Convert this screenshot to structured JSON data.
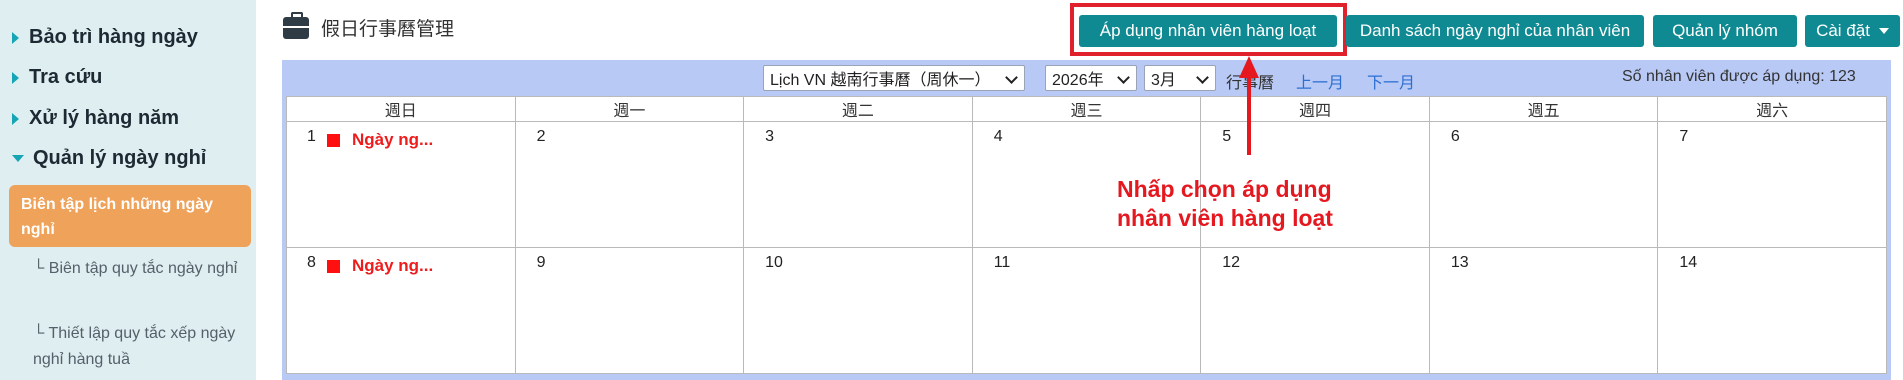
{
  "sidebar": {
    "items": [
      {
        "label": "Bảo trì hàng ngày"
      },
      {
        "label": "Tra cứu"
      },
      {
        "label": "Xử lý hàng năm"
      },
      {
        "label": "Quản lý ngày nghỉ"
      }
    ],
    "active_item": "Biên tập lịch những ngày nghỉ",
    "sub_items": [
      {
        "label": "└ Biên tập quy tắc ngày nghỉ"
      },
      {
        "label": "└ Thiết lập quy tắc xếp ngày nghỉ hàng tuầ"
      }
    ]
  },
  "header": {
    "title": "假日行事曆管理",
    "buttons": {
      "apply_bulk": "Áp dụng nhân viên hàng loạt",
      "employee_holiday_list": "Danh sách ngày nghỉ của nhân viên",
      "group_management": "Quản lý nhóm",
      "settings": "Cài đặt"
    }
  },
  "controls": {
    "calendar_select": "Lịch VN 越南行事曆（周休一）",
    "year_select": "2026年",
    "month_select": "3月",
    "calendar_label": "行事曆",
    "prev_month": "上一月",
    "next_month": "下一月",
    "applied_count_text": "Số nhân viên được áp dụng: 123"
  },
  "calendar": {
    "weekdays": [
      "週日",
      "週一",
      "週二",
      "週三",
      "週四",
      "週五",
      "週六"
    ],
    "weeks": [
      [
        {
          "day": "1",
          "event": "Ngày ng..."
        },
        {
          "day": "2"
        },
        {
          "day": "3"
        },
        {
          "day": "4"
        },
        {
          "day": "5"
        },
        {
          "day": "6"
        },
        {
          "day": "7"
        }
      ],
      [
        {
          "day": "8",
          "event": "Ngày ng..."
        },
        {
          "day": "9"
        },
        {
          "day": "10"
        },
        {
          "day": "11"
        },
        {
          "day": "12"
        },
        {
          "day": "13"
        },
        {
          "day": "14"
        }
      ]
    ]
  },
  "annotation": {
    "line1": "Nhấp chọn áp dụng",
    "line2": "nhân viên hàng loạt"
  },
  "colors": {
    "accent_button": "#0f8a92",
    "sidebar_active": "#eea25a",
    "highlight_red": "#e0202a",
    "holiday_red": "#ee1c1c",
    "calendar_band": "#b8c9f6"
  },
  "icons": [
    "briefcase-icon",
    "chevron-right-icon",
    "chevron-down-icon",
    "holiday-marker-icon",
    "arrow-up-icon"
  ]
}
